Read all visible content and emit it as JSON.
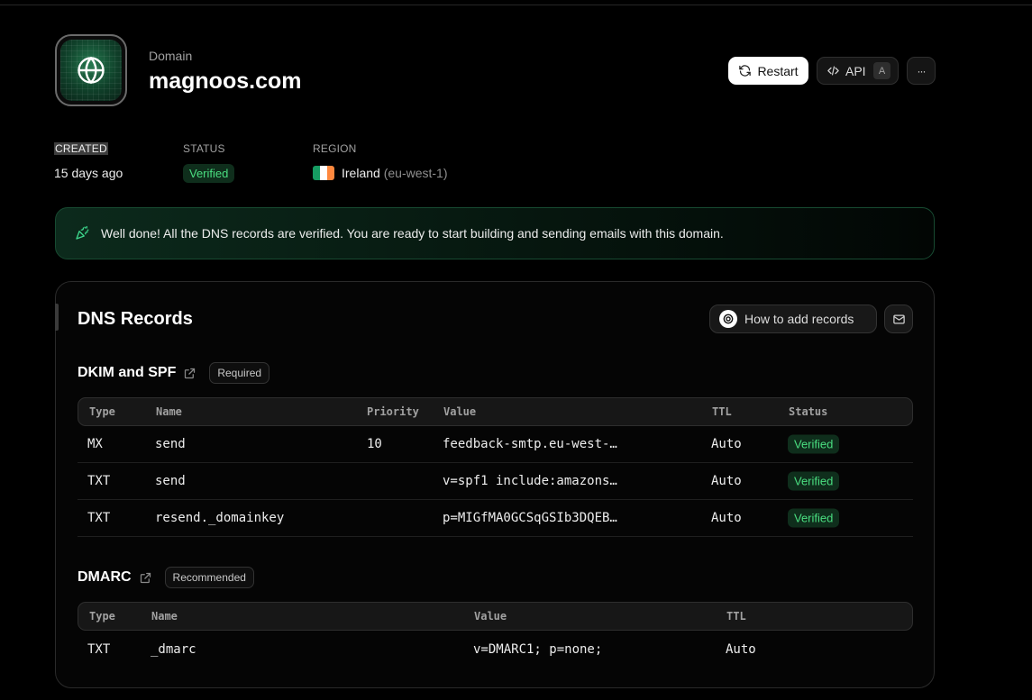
{
  "header": {
    "eyebrow": "Domain",
    "title": "magnoos.com",
    "actions": {
      "restart_label": "Restart",
      "api_label": "API",
      "api_shortcut": "A",
      "more_label": "···"
    }
  },
  "meta": {
    "created_label": "CREATED",
    "created_value": "15 days ago",
    "status_label": "STATUS",
    "status_value": "Verified",
    "region_label": "REGION",
    "region_name": "Ireland",
    "region_code": "(eu-west-1)"
  },
  "banner": {
    "text": "Well done! All the DNS records are verified. You are ready to start building and sending emails with this domain."
  },
  "dns": {
    "title": "DNS Records",
    "how_to_label": "How to add records",
    "dkim": {
      "title": "DKIM and SPF",
      "badge": "Required",
      "headers": [
        "Type",
        "Name",
        "Priority",
        "Value",
        "TTL",
        "Status"
      ],
      "rows": [
        {
          "type": "MX",
          "name": "send",
          "priority": "10",
          "value": "feedback-smtp.eu-west-…",
          "ttl": "Auto",
          "status": "Verified"
        },
        {
          "type": "TXT",
          "name": "send",
          "priority": "",
          "value": "v=spf1 include:amazons…",
          "ttl": "Auto",
          "status": "Verified"
        },
        {
          "type": "TXT",
          "name": "resend._domainkey",
          "priority": "",
          "value": "p=MIGfMA0GCSqGSIb3DQEB…",
          "ttl": "Auto",
          "status": "Verified"
        }
      ]
    },
    "dmarc": {
      "title": "DMARC",
      "badge": "Recommended",
      "headers": [
        "Type",
        "Name",
        "Value",
        "TTL"
      ],
      "rows": [
        {
          "type": "TXT",
          "name": "_dmarc",
          "value": "v=DMARC1; p=none;",
          "ttl": "Auto"
        }
      ]
    }
  },
  "colors": {
    "verified_text": "#4ade80",
    "verified_bg": "#0f2e1c",
    "flag": [
      "#169b62",
      "#ffffff",
      "#ff883e"
    ]
  },
  "icons": {
    "domain": "globe-icon",
    "restart": "refresh-icon",
    "api": "code-icon",
    "banner": "party-popper-icon",
    "external": "external-link-icon",
    "mail": "mail-icon"
  }
}
